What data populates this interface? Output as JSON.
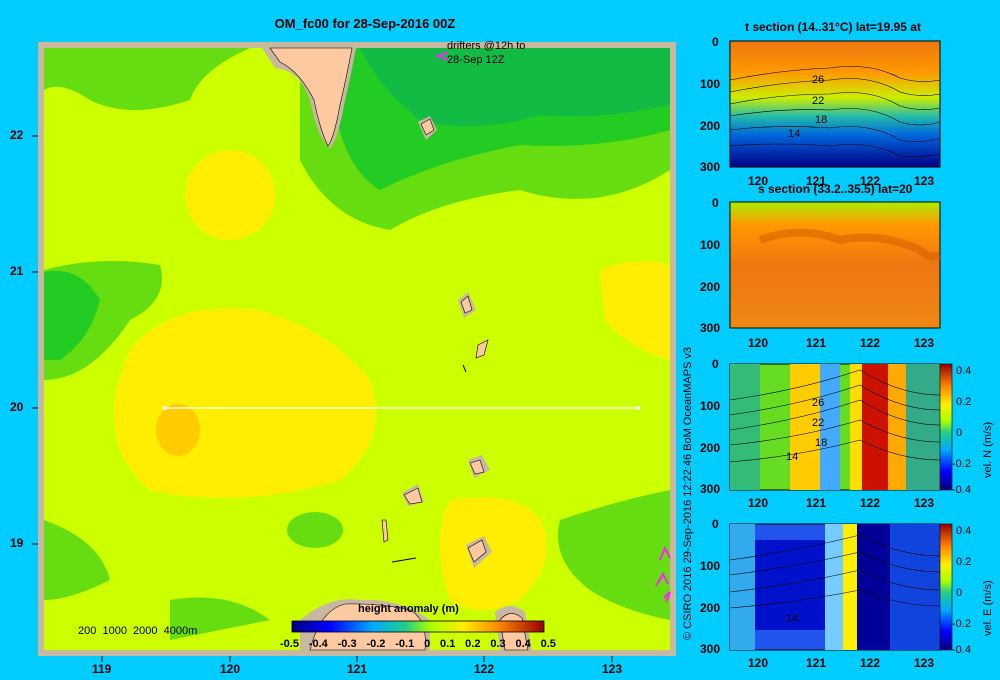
{
  "main_map": {
    "title": "OM_fc00 for 28-Sep-2016 00Z",
    "drifter_note_line1": "drifters @12h to",
    "drifter_note_line2": "28-Sep 12Z",
    "x_ticks": [
      "119",
      "120",
      "121",
      "122",
      "123"
    ],
    "y_ticks": [
      "22",
      "21",
      "20",
      "19"
    ],
    "depth_legend": "200  1000  2000  4000m",
    "colorbar_title": "height anomaly  (m)",
    "colorbar_ticks": [
      "-0.5",
      "-0.4",
      "-0.3",
      "-0.2",
      "-0.1",
      "0",
      "0.1",
      "0.2",
      "0.3",
      "0.4",
      "0.5"
    ],
    "section_line": {
      "lat": 20,
      "lon_start": 119.5,
      "lon_end": 123.2
    }
  },
  "credit": "© CSIRO 2016  29-Sep-2016 12:22:46 BoM OceanMAPS v3",
  "panels": [
    {
      "title": "t section (14..31°C) lat=19.95 at",
      "y_ticks": [
        "0",
        "100",
        "200",
        "300"
      ],
      "x_ticks": [
        "120",
        "121",
        "122",
        "123"
      ],
      "contour_labels": [
        "26",
        "22",
        "18",
        "14"
      ]
    },
    {
      "title": "s section (33.2..35.5) lat=20",
      "y_ticks": [
        "0",
        "100",
        "200",
        "300"
      ],
      "x_ticks": [
        "120",
        "121",
        "122",
        "123"
      ]
    },
    {
      "y_ticks": [
        "0",
        "100",
        "200",
        "300"
      ],
      "x_ticks": [
        "120",
        "121",
        "122",
        "123"
      ],
      "contour_labels": [
        "26",
        "22",
        "18",
        "14"
      ],
      "colorbar_label": "vel. N  (m/s)",
      "colorbar_ticks": [
        "0.4",
        "0.2",
        "0",
        "-0.2",
        "-0.4"
      ]
    },
    {
      "y_ticks": [
        "0",
        "100",
        "200",
        "300"
      ],
      "x_ticks": [
        "120",
        "121",
        "122",
        "123"
      ],
      "contour_labels": [
        "14"
      ],
      "colorbar_label": "vel. E  (m/s)",
      "colorbar_ticks": [
        "0.4",
        "0.2",
        "0",
        "-0.2",
        "-0.4"
      ]
    }
  ]
}
